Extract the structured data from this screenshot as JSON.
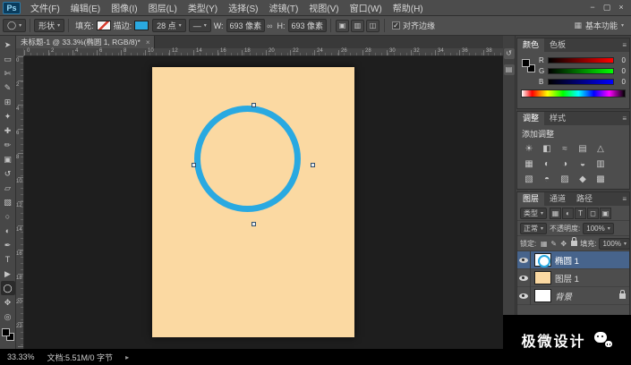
{
  "icons": {
    "caret": "▾",
    "check": "✓",
    "menu": "≡",
    "link": "∞",
    "grid": "▦",
    "stroke_line": "—",
    "tab_close": "×",
    "preset": "◯",
    "status_arrow": "▸"
  },
  "menubar": {
    "logo": "Ps",
    "items": [
      "文件(F)",
      "编辑(E)",
      "图像(I)",
      "图层(L)",
      "类型(Y)",
      "选择(S)",
      "滤镜(T)",
      "视图(V)",
      "窗口(W)",
      "帮助(H)"
    ],
    "window_controls": [
      "−",
      "▢",
      "×"
    ]
  },
  "options": {
    "mode": "形状",
    "fill_label": "填充:",
    "stroke_label": "描边:",
    "stroke_size": "28 点",
    "w_label": "W:",
    "w_value": "693 像素",
    "h_label": "H:",
    "h_value": "693 像素",
    "align_edges": "对齐边缘",
    "workspace": "基本功能",
    "path_ops": [
      {
        "name": "combine-shapes",
        "glyph": "▣"
      },
      {
        "name": "path-alignment",
        "glyph": "▥"
      },
      {
        "name": "path-arrange",
        "glyph": "◫"
      }
    ]
  },
  "document": {
    "tab_title": "未标题-1 @ 33.3%(椭圆 1, RGB/8)*"
  },
  "rulers": {
    "top": [
      "0",
      "2",
      "4",
      "6",
      "8",
      "10",
      "12",
      "14",
      "16",
      "18",
      "20",
      "22",
      "24",
      "26",
      "28",
      "30",
      "32",
      "34",
      "36",
      "38"
    ],
    "left": [
      "0",
      "2",
      "4",
      "6",
      "8",
      "10",
      "12",
      "14",
      "16",
      "18",
      "20",
      "22"
    ]
  },
  "tools": [
    {
      "name": "move-tool",
      "glyph": "➤"
    },
    {
      "name": "marquee-tool",
      "glyph": "▭"
    },
    {
      "name": "lasso-tool",
      "glyph": "✄"
    },
    {
      "name": "quick-selection-tool",
      "glyph": "✎"
    },
    {
      "name": "crop-tool",
      "glyph": "⊞"
    },
    {
      "name": "eyedropper-tool",
      "glyph": "✦"
    },
    {
      "name": "healing-brush-tool",
      "glyph": "✚"
    },
    {
      "name": "brush-tool",
      "glyph": "✏"
    },
    {
      "name": "clone-stamp-tool",
      "glyph": "▣"
    },
    {
      "name": "history-brush-tool",
      "glyph": "↺"
    },
    {
      "name": "eraser-tool",
      "glyph": "▱"
    },
    {
      "name": "gradient-tool",
      "glyph": "▧"
    },
    {
      "name": "blur-tool",
      "glyph": "○"
    },
    {
      "name": "dodge-tool",
      "glyph": "◐"
    },
    {
      "name": "pen-tool",
      "glyph": "✒"
    },
    {
      "name": "type-tool",
      "glyph": "T"
    },
    {
      "name": "path-selection-tool",
      "glyph": "▶"
    },
    {
      "name": "ellipse-tool",
      "glyph": "◯",
      "active": true
    },
    {
      "name": "hand-tool",
      "glyph": "✥"
    },
    {
      "name": "zoom-tool",
      "glyph": "◎"
    }
  ],
  "dock_icons": [
    {
      "name": "history-panel",
      "glyph": "↺"
    },
    {
      "name": "properties-panel",
      "glyph": "▤"
    }
  ],
  "color_panel": {
    "tab_color": "颜色",
    "tab_swatches": "色板",
    "channels": [
      {
        "label": "R",
        "value": "0"
      },
      {
        "label": "G",
        "value": "0"
      },
      {
        "label": "B",
        "value": "0"
      }
    ]
  },
  "adjustments_panel": {
    "tab_adjustments": "调整",
    "tab_styles": "样式",
    "title": "添加调整",
    "icons": [
      {
        "name": "brightness-contrast",
        "glyph": "☀"
      },
      {
        "name": "levels",
        "glyph": "◧"
      },
      {
        "name": "curves",
        "glyph": "≈"
      },
      {
        "name": "exposure",
        "glyph": "▤"
      },
      {
        "name": "vibrance",
        "glyph": "△"
      },
      {
        "name": "hue-saturation",
        "glyph": "▦"
      },
      {
        "name": "color-balance",
        "glyph": "◐"
      },
      {
        "name": "black-white",
        "glyph": "◑"
      },
      {
        "name": "photo-filter",
        "glyph": "◒"
      },
      {
        "name": "channel-mixer",
        "glyph": "▥"
      },
      {
        "name": "color-lookup",
        "glyph": "▧"
      },
      {
        "name": "invert",
        "glyph": "◓"
      },
      {
        "name": "posterize",
        "glyph": "▨"
      },
      {
        "name": "threshold",
        "glyph": "◆"
      },
      {
        "name": "gradient-map",
        "glyph": "▩"
      },
      {
        "name": "selective-color",
        "glyph": "◇"
      }
    ]
  },
  "layers_panel": {
    "tab_layers": "图层",
    "tab_channels": "通道",
    "tab_paths": "路径",
    "filter_label": "类型",
    "filter_icons": [
      {
        "name": "filter-pixel-layers",
        "glyph": "▦"
      },
      {
        "name": "filter-adjustment-layers",
        "glyph": "◐"
      },
      {
        "name": "filter-type-layers",
        "glyph": "T"
      },
      {
        "name": "filter-shape-layers",
        "glyph": "◻"
      },
      {
        "name": "filter-smart-objects",
        "glyph": "▣"
      }
    ],
    "blend_mode": "正常",
    "opacity_label": "不透明度:",
    "opacity_value": "100%",
    "lock_label": "锁定:",
    "lock_icons": [
      {
        "name": "lock-transparent-pixels",
        "glyph": "▦"
      },
      {
        "name": "lock-image-pixels",
        "glyph": "✎"
      },
      {
        "name": "lock-position",
        "glyph": "✥"
      }
    ],
    "fill_label": "填充:",
    "fill_value": "100%",
    "layers": [
      {
        "name": "椭圆 1",
        "kind": "shape",
        "selected": true
      },
      {
        "name": "图层 1",
        "kind": "fill",
        "selected": false
      },
      {
        "name": "背景",
        "kind": "background",
        "selected": false,
        "locked": true
      }
    ]
  },
  "status_bar": {
    "zoom": "33.33%",
    "doc_info": "文档:5.51M/0 字节"
  },
  "watermark": {
    "text": "极微设计"
  },
  "colors": {
    "accent_blue": "#29a9e1",
    "document_bg": "#fbd9a2",
    "selection_blue": "#47648c"
  }
}
